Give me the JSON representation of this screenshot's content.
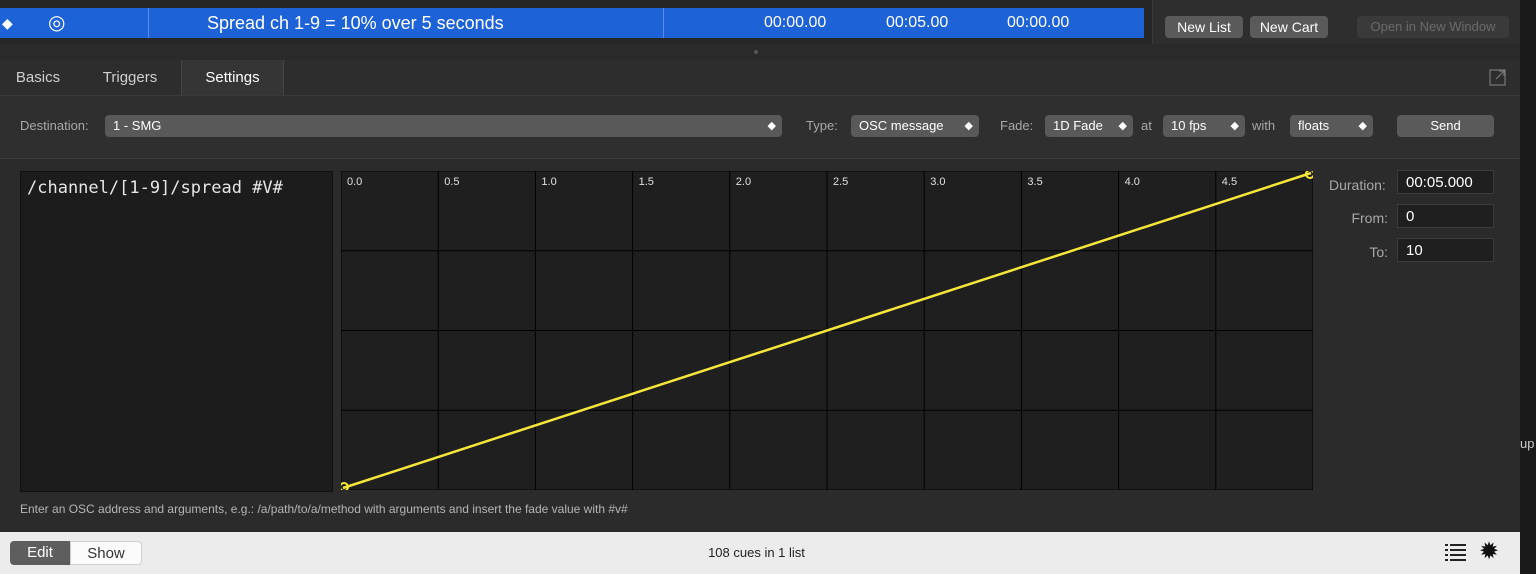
{
  "cue": {
    "name": "Spread ch 1-9 = 10% over 5 seconds",
    "pre_wait": "00:00.00",
    "action": "00:05.00",
    "post_wait": "00:00.00"
  },
  "right_pane": {
    "new_list": "New List",
    "new_cart": "New Cart",
    "open_new_window": "Open in New Window"
  },
  "tabs": [
    "Basics",
    "Triggers",
    "Settings"
  ],
  "settings": {
    "destination_label": "Destination:",
    "destination_value": "1 - SMG",
    "type_label": "Type:",
    "type_value": "OSC message",
    "fade_label": "Fade:",
    "fade_value": "1D Fade",
    "at_label": "at",
    "fps_value": "10 fps",
    "with_label": "with",
    "floats_value": "floats",
    "send": "Send"
  },
  "osc_message": "/channel/[1-9]/spread #V#",
  "fade_params": {
    "duration_label": "Duration:",
    "duration_value": "00:05.000",
    "from_label": "From:",
    "from_value": "0",
    "to_label": "To:",
    "to_value": "10"
  },
  "hint": "Enter an OSC address and arguments, e.g.: /a/path/to/a/method with arguments and insert the fade value with #v#",
  "bottom": {
    "edit": "Edit",
    "show": "Show",
    "status": "108 cues in 1 list"
  },
  "side_text": "up",
  "colors": {
    "selection": "#1e62d8",
    "curve": "#f5e63a"
  },
  "chart_data": {
    "type": "line",
    "x_ticks": [
      "0.0",
      "0.5",
      "1.0",
      "1.5",
      "2.0",
      "2.5",
      "3.0",
      "3.5",
      "4.0",
      "4.5"
    ],
    "xlim": [
      0,
      5
    ],
    "ylim": [
      0,
      10
    ],
    "series": [
      {
        "x": [
          0,
          5
        ],
        "y": [
          0,
          10
        ]
      }
    ]
  }
}
